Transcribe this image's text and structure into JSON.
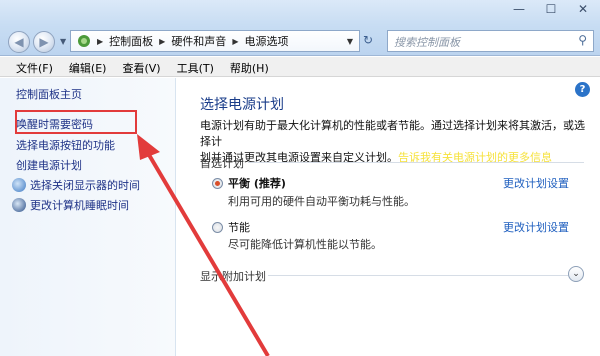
{
  "window": {
    "minimize": "—",
    "maximize": "☐",
    "close": "✕"
  },
  "address": {
    "crumbs": [
      "控制面板",
      "硬件和声音",
      "电源选项"
    ],
    "search_placeholder": "搜索控制面板"
  },
  "menu": [
    "文件(F)",
    "编辑(E)",
    "查看(V)",
    "工具(T)",
    "帮助(H)"
  ],
  "sidebar": {
    "home": "控制面板主页",
    "items": [
      {
        "label": "唤醒时需要密码"
      },
      {
        "label": "选择电源按钮的功能"
      },
      {
        "label": "创建电源计划"
      },
      {
        "label": "选择关闭显示器的时间"
      },
      {
        "label": "更改计算机睡眠时间"
      }
    ]
  },
  "main": {
    "title": "选择电源计划",
    "desc_line1": "电源计划有助于最大化计算机的性能或者节能。通过选择计划来将其激活，或选择计",
    "desc_line2": "划并通过更改其电源设置来自定义计划。",
    "desc_link": "告诉我有关电源计划的更多信息",
    "preferred_label": "首选计划",
    "plans": [
      {
        "name": "平衡 (推荐)",
        "desc": "利用可用的硬件自动平衡功耗与性能。",
        "selected": true,
        "change": "更改计划设置"
      },
      {
        "name": "节能",
        "desc": "尽可能降低计算机性能以节能。",
        "selected": false,
        "change": "更改计划设置"
      }
    ],
    "extra_label": "显示附加计划"
  },
  "colors": {
    "highlight": "#e23b3b",
    "arrow": "#e23b3b",
    "link": "#1f5fbf"
  }
}
